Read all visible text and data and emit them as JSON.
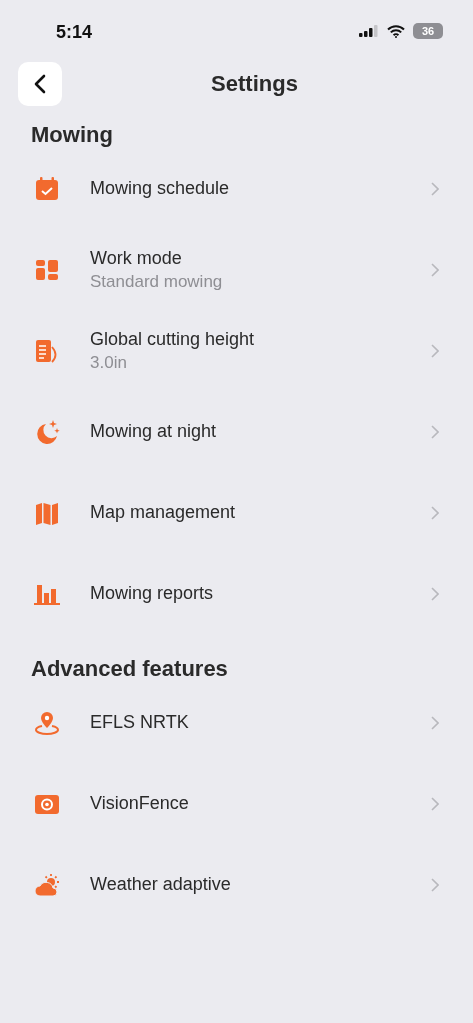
{
  "status_bar": {
    "time": "5:14",
    "battery": "36"
  },
  "header": {
    "title": "Settings"
  },
  "sections": [
    {
      "title": "Mowing",
      "items": [
        {
          "label": "Mowing schedule"
        },
        {
          "label": "Work mode",
          "value": "Standard mowing"
        },
        {
          "label": "Global cutting height",
          "value": "3.0in"
        },
        {
          "label": "Mowing at night"
        },
        {
          "label": "Map management"
        },
        {
          "label": "Mowing reports"
        }
      ]
    },
    {
      "title": "Advanced features",
      "items": [
        {
          "label": "EFLS NRTK"
        },
        {
          "label": "VisionFence"
        },
        {
          "label": "Weather adaptive"
        }
      ]
    }
  ]
}
